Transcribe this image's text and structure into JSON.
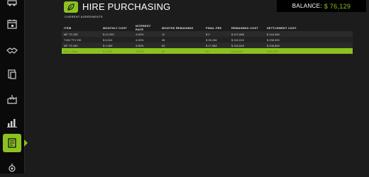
{
  "header": {
    "title": "HIRE PURCHASING",
    "balance_label": "BALANCE:",
    "balance_value": "$ 76,129"
  },
  "section": {
    "title": "CURRENT AGREEMENTS"
  },
  "table": {
    "columns": [
      "ITEM",
      "MONTHLY COST",
      "INTEREST RATE",
      "MONTHS REMAINING",
      "FINAL FEE",
      "REMAINING COST",
      "SETTLEMENT COST"
    ],
    "rows": [
      [
        "MF 7S.155",
        "$ 12,299",
        "4.00%",
        "11",
        "$ 0",
        "$ 147,888",
        "$ 144,460"
      ],
      [
        "7150 TTV HD",
        "$ 6,024",
        "4.00%",
        "36",
        "$ 25,156",
        "$ 242,024",
        "$ 236,300"
      ],
      [
        "MF 7S.180",
        "$ 2,269",
        "3.50%",
        "60",
        "$ 17,558",
        "$ 152,849",
        "$ 136,880"
      ],
      [
        "311 e Gear",
        "$ 1,800",
        "3.50%",
        "56",
        "$ 0",
        "$ 64,816",
        "$ 62,130"
      ]
    ]
  },
  "sidebar": {
    "items": [
      "vehicles-icon",
      "calendar-icon",
      "handshake-icon",
      "finance-icon",
      "factory-icon",
      "statistics-icon",
      "contract-icon",
      "gear-bag-icon"
    ],
    "active": "contract-icon"
  },
  "colors": {
    "accent": "#8cc220",
    "background": "#1c1c1c",
    "sidebar": "#0a0a0a"
  }
}
